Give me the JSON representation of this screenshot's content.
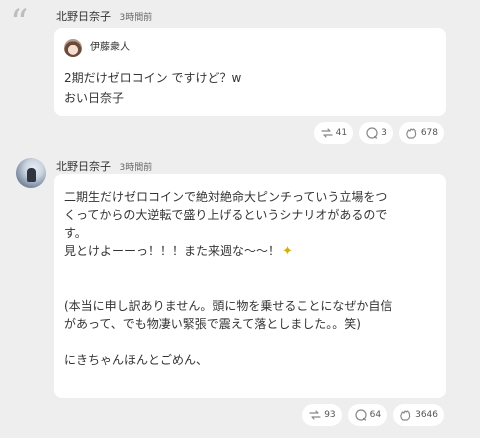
{
  "thread": {
    "quote_mark": "“",
    "post1": {
      "author": "北野日奈子",
      "time": "3時間前",
      "quoted_author": "伊藤衆人",
      "lines": [
        "2期だけゼロコイン ですけど？w",
        "おい日奈子"
      ],
      "actions": {
        "reposts": "41",
        "comments": "3",
        "reactions": "678"
      }
    },
    "post2": {
      "author": "北野日奈子",
      "time": "3時間前",
      "lines": [
        "二期生だけゼロコインで絶対絶命大ピンチっていう立場をつ",
        "くってからの大逆転で盛り上げるというシナリオがあるので",
        "す。",
        "見とけよーーっ！！！また来週な〜〜！",
        "",
        "",
        "(本当に申し訳ありません。頭に物を乗せることになぜか自信",
        "があって、でも物凄い緊張で震えて落としました。。笑)",
        "",
        "にきちゃんほんとごめん、"
      ],
      "actions": {
        "reposts": "93",
        "comments": "64",
        "reactions": "3646"
      }
    }
  },
  "icons": {
    "quote": "quote-icon",
    "repost": "repost-icon",
    "comment": "comment-icon",
    "reaction": "reaction-icon",
    "sparkle": "sparkle-icon"
  },
  "colors": {
    "background": "#eeeeee",
    "bubble": "#ffffff",
    "icon": "#888888",
    "sparkle": "#d4b200"
  }
}
